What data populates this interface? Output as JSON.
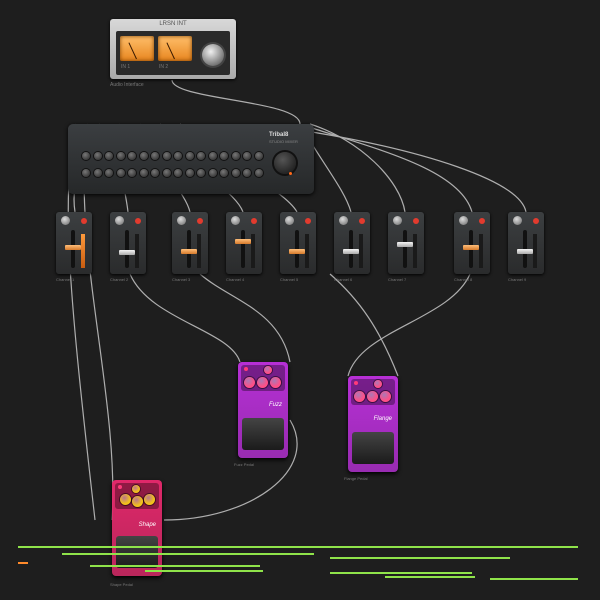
{
  "interface": {
    "title": "LRSN INT",
    "label": "Audio Interface",
    "left_meter_label": "IN 1",
    "right_meter_label": "IN 2"
  },
  "mixer": {
    "brand": "Tribal8",
    "subtitle": "STUDIO MIXER",
    "channel_numbers": [
      "1",
      "2",
      "3",
      "4",
      "5",
      "6",
      "7",
      "8",
      "9",
      "10",
      "11",
      "12",
      "13",
      "14",
      "15",
      "16"
    ]
  },
  "channels": [
    {
      "label": "Channel 1",
      "fader": 0.55,
      "meter_on": true,
      "orange": true
    },
    {
      "label": "Channel 2",
      "fader": 0.4,
      "meter_on": false,
      "orange": false
    },
    {
      "label": "Channel 3",
      "fader": 0.45,
      "meter_on": false,
      "orange": true
    },
    {
      "label": "Channel 4",
      "fader": 0.75,
      "meter_on": false,
      "orange": true
    },
    {
      "label": "Channel 5",
      "fader": 0.45,
      "meter_on": false,
      "orange": true
    },
    {
      "label": "Channel 6",
      "fader": 0.45,
      "meter_on": false,
      "orange": false
    },
    {
      "label": "Channel 7",
      "fader": 0.65,
      "meter_on": false,
      "orange": false
    },
    {
      "label": "Channel 8",
      "fader": 0.55,
      "meter_on": false,
      "orange": true
    },
    {
      "label": "Channel 9",
      "fader": 0.45,
      "meter_on": false,
      "orange": false
    }
  ],
  "pedals": [
    {
      "name": "Shape",
      "label": "Shape Pedal",
      "color": "#e0286a",
      "knob_color": "#f2c21a"
    },
    {
      "name": "Fuzz",
      "label": "Fuzz Pedal",
      "color": "#b72fd6",
      "knob_color": "#ff4f86"
    },
    {
      "name": "Flange",
      "label": "Flange Pedal",
      "color": "#b72fd6",
      "knob_color": "#ff4f86"
    }
  ],
  "colors": {
    "background": "#1e1e1e",
    "cable": "#c8c8c8",
    "clip_green": "#8fe34a",
    "clip_orange": "#ff8a2b"
  }
}
